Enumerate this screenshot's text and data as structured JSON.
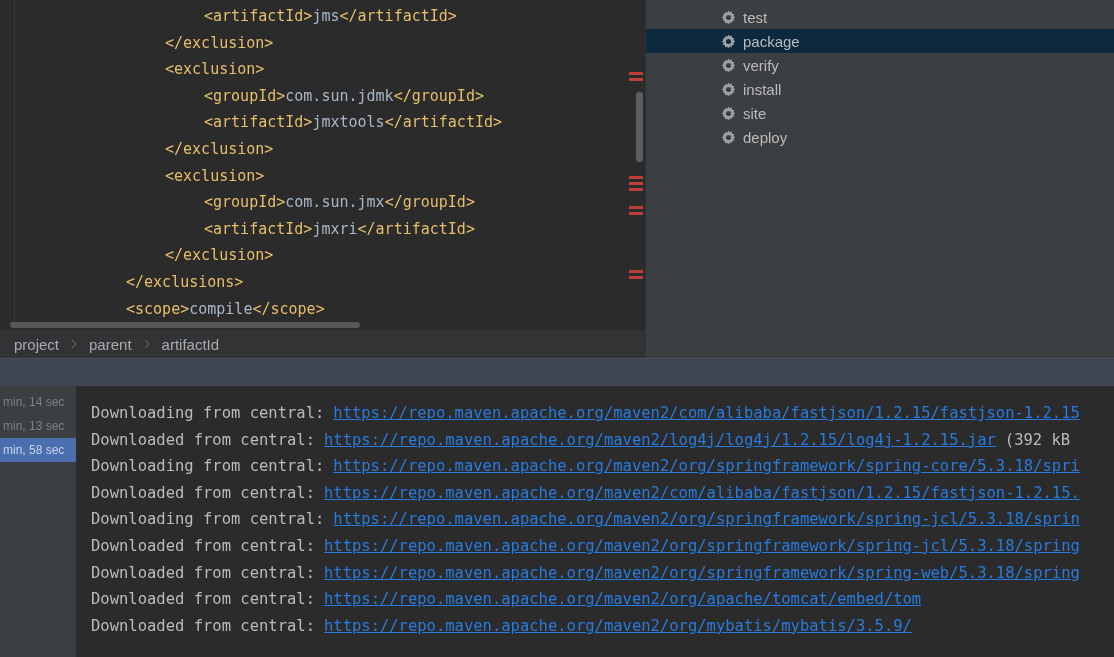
{
  "editor": {
    "lines": [
      {
        "children": [
          {
            "children": [
              {
                "tokens": [
                  {
                    "kind": "tag",
                    "text": "<artifactId>"
                  },
                  {
                    "kind": "text",
                    "text": "jms"
                  },
                  {
                    "kind": "tag",
                    "text": "</artifactId>"
                  }
                ]
              }
            ]
          },
          {
            "tokens": [
              {
                "kind": "tag",
                "text": "</exclusion>"
              }
            ]
          },
          {
            "tokens": [
              {
                "kind": "tag",
                "text": "<exclusion>"
              }
            ],
            "children": [
              {
                "tokens": [
                  {
                    "kind": "tag",
                    "text": "<groupId>"
                  },
                  {
                    "kind": "text",
                    "text": "com.sun.jdmk"
                  },
                  {
                    "kind": "tag",
                    "text": "</groupId>"
                  }
                ]
              },
              {
                "tokens": [
                  {
                    "kind": "tag",
                    "text": "<artifactId>"
                  },
                  {
                    "kind": "text",
                    "text": "jmxtools"
                  },
                  {
                    "kind": "tag",
                    "text": "</artifactId>"
                  }
                ]
              }
            ]
          },
          {
            "tokens": [
              {
                "kind": "tag",
                "text": "</exclusion>"
              }
            ]
          },
          {
            "tokens": [
              {
                "kind": "tag",
                "text": "<exclusion>"
              }
            ],
            "children": [
              {
                "tokens": [
                  {
                    "kind": "tag",
                    "text": "<groupId>"
                  },
                  {
                    "kind": "text",
                    "text": "com.sun.jmx"
                  },
                  {
                    "kind": "tag",
                    "text": "</groupId>"
                  }
                ]
              },
              {
                "tokens": [
                  {
                    "kind": "tag",
                    "text": "<artifactId>"
                  },
                  {
                    "kind": "text",
                    "text": "jmxri"
                  },
                  {
                    "kind": "tag",
                    "text": "</artifactId>"
                  }
                ]
              }
            ]
          },
          {
            "tokens": [
              {
                "kind": "tag",
                "text": "</exclusion>"
              }
            ]
          }
        ]
      },
      {
        "tokens": [
          {
            "kind": "tag",
            "text": "</exclusions>"
          }
        ]
      },
      {
        "tokens": [
          {
            "kind": "tag",
            "text": "<scope>"
          },
          {
            "kind": "text",
            "text": "compile"
          },
          {
            "kind": "tag",
            "text": "</scope>"
          }
        ]
      }
    ]
  },
  "breadcrumb": [
    "project",
    "parent",
    "artifactId"
  ],
  "lifecycle": {
    "items": [
      {
        "label": "test",
        "selected": false
      },
      {
        "label": "package",
        "selected": true
      },
      {
        "label": "verify",
        "selected": false
      },
      {
        "label": "install",
        "selected": false
      },
      {
        "label": "site",
        "selected": false
      },
      {
        "label": "deploy",
        "selected": false
      }
    ]
  },
  "run_history": [
    {
      "label": "min, 14 sec",
      "selected": false
    },
    {
      "label": "min, 13 sec",
      "selected": false
    },
    {
      "label": "min, 58 sec",
      "selected": true
    }
  ],
  "console": {
    "lines": [
      {
        "prefix": "Downloading from central:",
        "url": "https://repo.maven.apache.org/maven2/com/alibaba/fastjson/1.2.15/fastjson-1.2.15"
      },
      {
        "prefix": "Downloaded from central:",
        "url": "https://repo.maven.apache.org/maven2/log4j/log4j/1.2.15/log4j-1.2.15.jar",
        "suffix": "(392 kB"
      },
      {
        "prefix": "Downloading from central:",
        "url": "https://repo.maven.apache.org/maven2/org/springframework/spring-core/5.3.18/spri"
      },
      {
        "prefix": "Downloaded from central:",
        "url": "https://repo.maven.apache.org/maven2/com/alibaba/fastjson/1.2.15/fastjson-1.2.15."
      },
      {
        "prefix": "Downloading from central:",
        "url": "https://repo.maven.apache.org/maven2/org/springframework/spring-jcl/5.3.18/sprin"
      },
      {
        "prefix": "Downloaded from central:",
        "url": "https://repo.maven.apache.org/maven2/org/springframework/spring-jcl/5.3.18/spring"
      },
      {
        "prefix": "Downloaded from central:",
        "url": "https://repo.maven.apache.org/maven2/org/springframework/spring-web/5.3.18/spring"
      },
      {
        "prefix": "Downloaded from central:",
        "url": "https://repo.maven.apache.org/maven2/org/apache/tomcat/embed/tom"
      },
      {
        "prefix": "Downloaded from central:",
        "url": "https://repo.maven.apache.org/maven2/org/mybatis/mybatis/3.5.9/"
      }
    ]
  }
}
